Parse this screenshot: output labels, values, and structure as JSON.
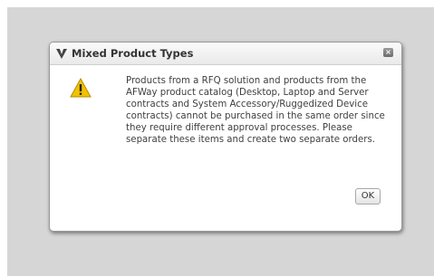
{
  "dialog": {
    "title": "Mixed Product Types",
    "message": "Products from a RFQ solution and products from the AFWay product catalog (Desktop, Laptop and Server contracts and System Accessory/Ruggedized Device contracts) cannot be purchased in the same order since they require different approval processes. Please separate these items and create two separate orders.",
    "ok_label": "OK",
    "close_label": "×",
    "icons": {
      "title": "afway-logo-icon",
      "message": "warning-icon",
      "close": "close-icon"
    },
    "colors": {
      "backdrop": "#d6d6d6",
      "warning": "#f2c200"
    }
  }
}
